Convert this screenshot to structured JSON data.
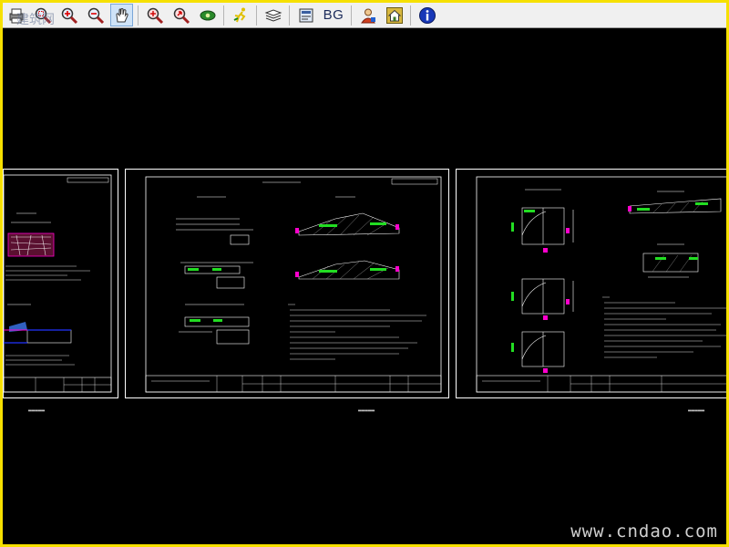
{
  "toolbar": {
    "buttons": [
      {
        "name": "print",
        "icon": "printer-icon"
      },
      {
        "name": "zoom-window",
        "icon": "zoom-window-icon"
      },
      {
        "name": "zoom-in",
        "icon": "zoom-in-icon"
      },
      {
        "name": "zoom-out",
        "icon": "zoom-out-icon"
      },
      {
        "name": "pan",
        "icon": "pan-hand-icon",
        "active": true
      },
      {
        "name": "zoom-extents",
        "icon": "zoom-extents-icon"
      },
      {
        "name": "zoom-previous",
        "icon": "zoom-previous-icon"
      },
      {
        "name": "view",
        "icon": "eye-icon"
      },
      {
        "name": "run",
        "icon": "run-figure-icon"
      },
      {
        "name": "layers",
        "icon": "layers-icon"
      },
      {
        "name": "properties",
        "icon": "properties-icon"
      },
      {
        "name": "background",
        "label": "BG"
      },
      {
        "name": "user",
        "icon": "user-icon"
      },
      {
        "name": "home",
        "icon": "home-icon"
      },
      {
        "name": "info",
        "icon": "info-icon"
      }
    ]
  },
  "watermarks": {
    "top_left": "建筑网",
    "bottom_right": "www.cndao.com"
  },
  "colors": {
    "frame": "#f6e000",
    "canvas": "#000000",
    "lines": "#ffffff",
    "accent_green": "#22dd22",
    "accent_magenta": "#ff00cc",
    "accent_blue": "#2233ff"
  }
}
